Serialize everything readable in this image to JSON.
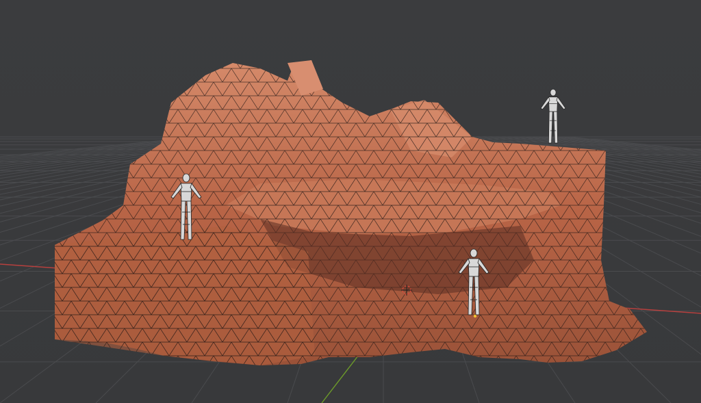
{
  "viewport": {
    "mode": "wireframe-overlay",
    "projection": "perspective",
    "background_color": "#3a3b3d",
    "grid": {
      "visible": true,
      "color": "#4a4b4e"
    },
    "x_axis_color": "#b8403e",
    "y_axis_color": "#6c9a2a",
    "origin_cursor_color": "#d04a3a"
  },
  "scene": {
    "objects": [
      {
        "name": "rock-cliff-mesh",
        "material": "red-sandstone",
        "base_color": "#c26a4a",
        "wireframe_color": "#1c1412"
      },
      {
        "name": "scale-figure",
        "count": 3,
        "color": "#d8d8d8"
      }
    ]
  }
}
